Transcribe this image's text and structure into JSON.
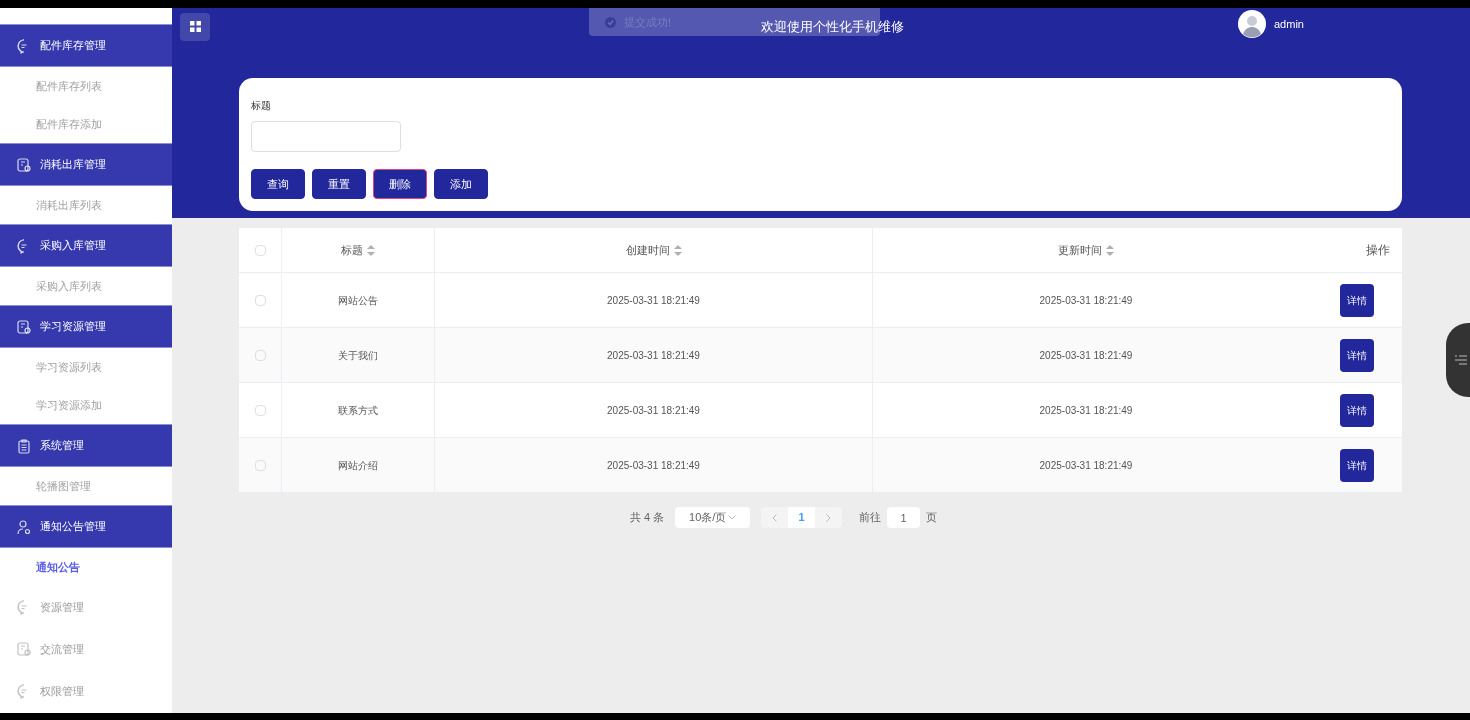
{
  "sidebar": {
    "items": [
      {
        "label": "配件库存管理",
        "kind": "chat",
        "expanded": true,
        "children": [
          {
            "label": "配件库存列表",
            "selected": false
          },
          {
            "label": "配件库存添加",
            "selected": false
          }
        ]
      },
      {
        "label": "消耗出库管理",
        "kind": "doc",
        "expanded": true,
        "children": [
          {
            "label": "消耗出库列表",
            "selected": false
          }
        ]
      },
      {
        "label": "采购入库管理",
        "kind": "chat",
        "expanded": true,
        "children": [
          {
            "label": "采购入库列表",
            "selected": false
          }
        ]
      },
      {
        "label": "学习资源管理",
        "kind": "doc",
        "expanded": true,
        "children": [
          {
            "label": "学习资源列表",
            "selected": false
          },
          {
            "label": "学习资源添加",
            "selected": false
          }
        ]
      },
      {
        "label": "系统管理",
        "kind": "clipboard",
        "expanded": true,
        "children": [
          {
            "label": "轮播图管理",
            "selected": false
          }
        ]
      },
      {
        "label": "通知公告管理",
        "kind": "user",
        "expanded": true,
        "children": [
          {
            "label": "通知公告",
            "selected": true
          }
        ]
      },
      {
        "label": "资源管理",
        "kind": "chat",
        "expanded": false
      },
      {
        "label": "交流管理",
        "kind": "doc",
        "expanded": false
      },
      {
        "label": "权限管理",
        "kind": "chat",
        "expanded": false
      }
    ]
  },
  "header": {
    "toast": "提交成功!",
    "title": "欢迎使用个性化手机维修",
    "user": "admin"
  },
  "search": {
    "label": "标题",
    "buttons": [
      {
        "label": "查询",
        "kind": "normal"
      },
      {
        "label": "重置",
        "kind": "normal"
      },
      {
        "label": "删除",
        "kind": "danger"
      },
      {
        "label": "添加",
        "kind": "normal"
      }
    ]
  },
  "table": {
    "select_all": {
      "checked": false
    },
    "columns": [
      {
        "label": "标题",
        "sortable": true
      },
      {
        "label": "创建时间",
        "sortable": true
      },
      {
        "label": "更新时间",
        "sortable": true
      },
      {
        "label": "操作",
        "sortable": false
      }
    ],
    "rows": [
      {
        "checked": false,
        "title": "网站公告",
        "created": "2025-03-31 18:21:49",
        "updated": "2025-03-31 18:21:49",
        "action": "详情"
      },
      {
        "checked": false,
        "title": "关于我们",
        "created": "2025-03-31 18:21:49",
        "updated": "2025-03-31 18:21:49",
        "action": "详情"
      },
      {
        "checked": false,
        "title": "联系方式",
        "created": "2025-03-31 18:21:49",
        "updated": "2025-03-31 18:21:49",
        "action": "详情"
      },
      {
        "checked": false,
        "title": "网站介绍",
        "created": "2025-03-31 18:21:49",
        "updated": "2025-03-31 18:21:49",
        "action": "详情"
      }
    ]
  },
  "pagination": {
    "total": "共 4 条",
    "page_size": "10条/页",
    "pages": [
      {
        "label": "1",
        "selected": true
      }
    ],
    "goto_label": "前往",
    "goto_value": "1",
    "goto_suffix": "页"
  }
}
